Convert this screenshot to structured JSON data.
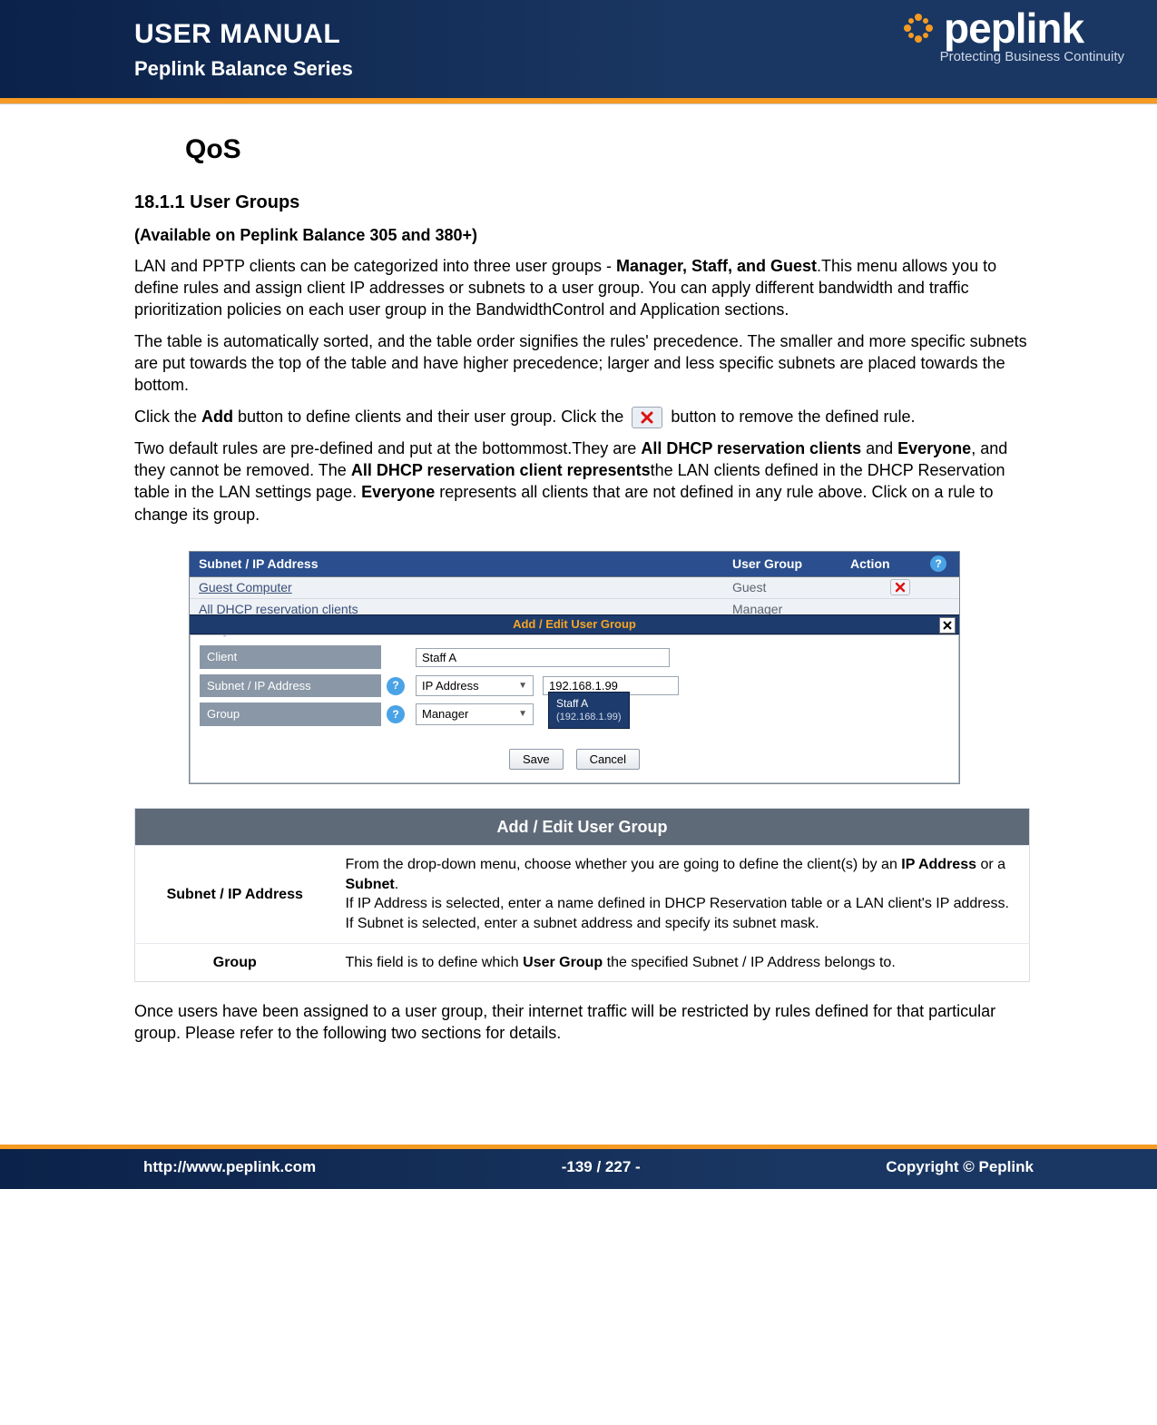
{
  "header": {
    "title": "USER MANUAL",
    "subtitle": "Peplink Balance Series",
    "logo_word": "peplink",
    "tagline": "Protecting Business Continuity"
  },
  "colors": {
    "brand_orange": "#f59a22",
    "brand_navy": "#1a3763",
    "table_header": "#5f6a78"
  },
  "content": {
    "qos_heading": "QoS",
    "sec_number_title": "18.1.1 User Groups",
    "availability": "(Available on Peplink Balance 305 and 380+)",
    "para1_a": "LAN and PPTP clients can be categorized into three user groups - ",
    "para1_b_bold": "Manager, Staff, and Guest",
    "para1_c": ".This menu allows you to define rules and assign client IP addresses or subnets to a user group. You can apply different bandwidth and traffic prioritization policies on each user group in the BandwidthControl and Application sections.",
    "para2": "The table is automatically sorted, and the table order signifies the rules' precedence. The smaller and more specific subnets are put towards the top of the table and have higher precedence; larger and less specific subnets are placed towards the bottom.",
    "para3_a": "Click the ",
    "para3_add": "Add",
    "para3_b": " button to define clients and their user group. Click the ",
    "para3_c": " button to remove the defined rule.",
    "para4_a": "Two default rules are pre-defined and put at the bottommost.They are ",
    "para4_b1": "All DHCP reservation clients",
    "para4_b2": " and ",
    "para4_b3": "Everyone",
    "para4_b4": ", and they cannot be removed. The ",
    "para4_b5": "All DHCP reservation client represents",
    "para4_b6": "the LAN clients defined in the DHCP Reservation table in the LAN settings page.  ",
    "para4_b7": "Everyone",
    "para4_b8": " represents all clients that are not defined in any rule above. Click on a rule to change its group.",
    "after_table": "Once users have been assigned to a user group, their internet traffic will be restricted by rules defined for that particular group. Please refer to the following two sections for details."
  },
  "screenshot": {
    "columns": {
      "c1": "Subnet / IP Address",
      "c2": "User Group",
      "c3": "Action"
    },
    "rows": [
      {
        "name": "Guest Computer",
        "group": "Guest",
        "removable": true
      },
      {
        "name": "All DHCP reservation clients",
        "group": "Manager",
        "removable": false
      }
    ],
    "everyone": "Everyone",
    "modal": {
      "title": "Add / Edit User Group",
      "labels": {
        "client": "Client",
        "subnet": "Subnet / IP Address",
        "group": "Group"
      },
      "client_value": "Staff A",
      "addr_mode": "IP Address",
      "addr_value": "192.168.1.99",
      "group_value": "Manager",
      "suggest_name": "Staff A",
      "suggest_ip": "(192.168.1.99)",
      "save": "Save",
      "cancel": "Cancel"
    }
  },
  "desc_table": {
    "title": "Add / Edit User Group",
    "rows": [
      {
        "key": "Subnet / IP Address",
        "val_a": "From the drop-down menu, choose whether you are going to define the client(s) by an ",
        "val_b1": "IP Address",
        "val_c": " or a ",
        "val_b2": "Subnet",
        "val_d": ".",
        "val_e": "If IP Address is selected, enter a name defined in DHCP Reservation table or a LAN client's IP address. If Subnet is selected, enter a subnet address and specify its subnet mask."
      },
      {
        "key": "Group",
        "val_a": "This field is to define which ",
        "val_b1": "User Group",
        "val_c": " the specified Subnet / IP Address belongs to.",
        "val_b2": "",
        "val_d": "",
        "val_e": ""
      }
    ]
  },
  "footer": {
    "left": "http://www.peplink.com",
    "center": "-139 / 227 -",
    "right": "Copyright ©  Peplink"
  }
}
